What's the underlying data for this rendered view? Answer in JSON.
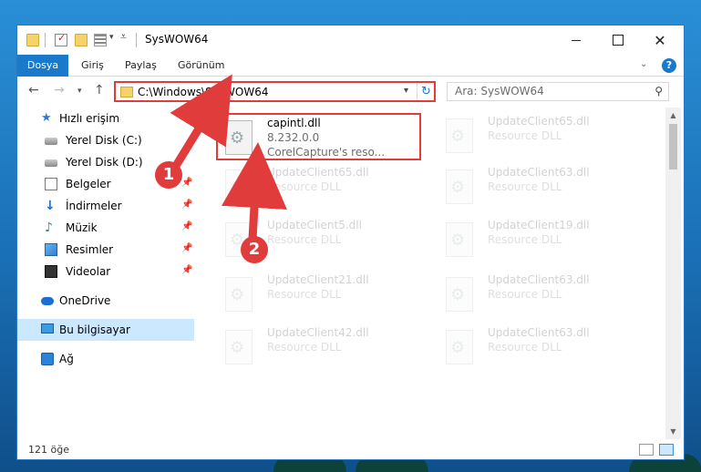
{
  "window": {
    "title": "SysWOW64",
    "quick_access_dropdown": "▾"
  },
  "ribbon": {
    "tabs": [
      "Dosya",
      "Giriş",
      "Paylaş",
      "Görünüm"
    ],
    "help": "?"
  },
  "nav": {
    "address_path": "C:\\Windows\\SysWOW64",
    "search_placeholder": "Ara: SysWOW64"
  },
  "sidebar": {
    "items": [
      {
        "label": "Hızlı erişim",
        "icon": "star-icon"
      },
      {
        "label": "Yerel Disk (C:)",
        "icon": "drive-icon"
      },
      {
        "label": "Yerel Disk (D:)",
        "icon": "drive-icon"
      },
      {
        "label": "Belgeler",
        "icon": "documents-icon",
        "pinned": true
      },
      {
        "label": "İndirmeler",
        "icon": "download-icon",
        "pinned": true
      },
      {
        "label": "Müzik",
        "icon": "music-icon",
        "pinned": true
      },
      {
        "label": "Resimler",
        "icon": "pictures-icon",
        "pinned": true
      },
      {
        "label": "Videolar",
        "icon": "videos-icon",
        "pinned": true
      },
      {
        "label": "OneDrive",
        "icon": "cloud-icon"
      },
      {
        "label": "Bu bilgisayar",
        "icon": "computer-icon",
        "selected": true
      },
      {
        "label": "Ağ",
        "icon": "network-icon"
      }
    ]
  },
  "files": [
    {
      "name": "capintl.dll",
      "line2": "8.232.0.0",
      "line3": "CorelCapture's reso...",
      "highlight": true
    },
    {
      "name": "UpdateClient65.dll",
      "line2": "Resource DLL"
    },
    {
      "name": "UpdateClient65.dll",
      "line2": "Resource DLL"
    },
    {
      "name": "UpdateClient63.dll",
      "line2": "Resource DLL"
    },
    {
      "name": "UpdateClient5.dll",
      "line2": "Resource DLL"
    },
    {
      "name": "UpdateClient19.dll",
      "line2": "Resource DLL"
    },
    {
      "name": "UpdateClient21.dll",
      "line2": "Resource DLL"
    },
    {
      "name": "UpdateClient63.dll",
      "line2": "Resource DLL"
    },
    {
      "name": "UpdateClient42.dll",
      "line2": "Resource DLL"
    },
    {
      "name": "UpdateClient63.dll",
      "line2": "Resource DLL"
    }
  ],
  "status": {
    "item_count": "121 öğe"
  },
  "annotations": {
    "step1": "1",
    "step2": "2",
    "color": "#e03c3c"
  }
}
